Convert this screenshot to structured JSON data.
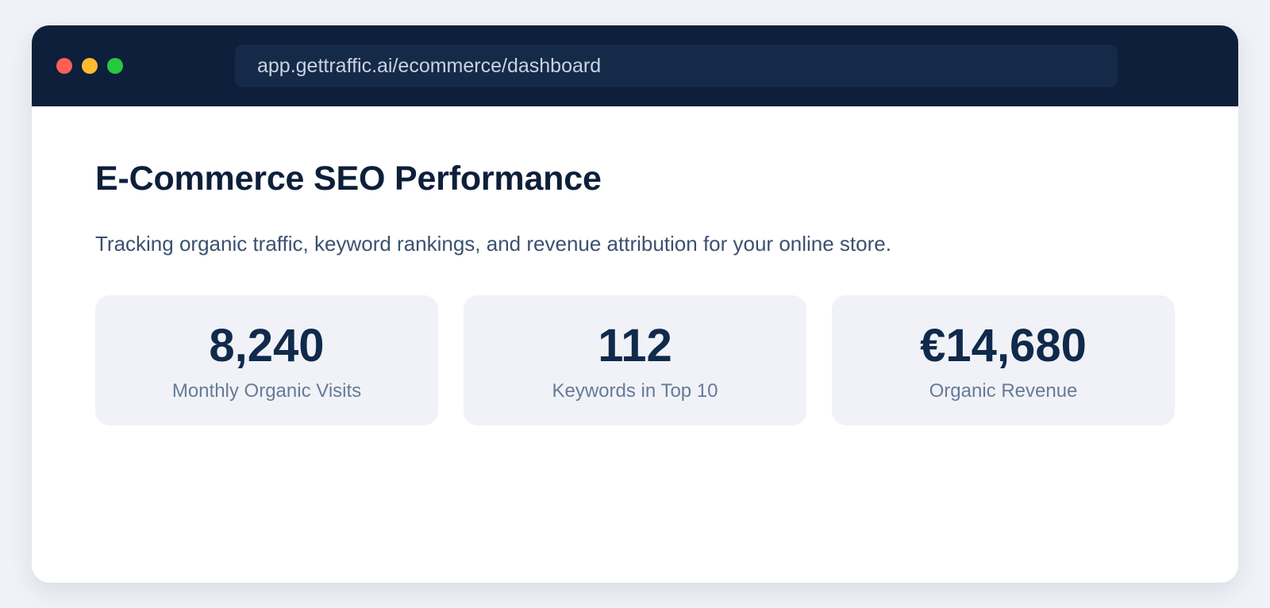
{
  "browser": {
    "url": "app.gettraffic.ai/ecommerce/dashboard"
  },
  "page": {
    "title": "E-Commerce SEO Performance",
    "subtitle": "Tracking organic traffic, keyword rankings, and revenue attribution for your online store."
  },
  "stats": [
    {
      "value": "8,240",
      "label": "Monthly Organic Visits"
    },
    {
      "value": "112",
      "label": "Keywords in Top 10"
    },
    {
      "value": "€14,680",
      "label": "Organic Revenue"
    }
  ],
  "colors": {
    "background": "#f0f2f7",
    "titlebar": "#0d1f3a",
    "address_bar": "#152a48",
    "heading": "#0d1f3a",
    "stat_value": "#102a4c",
    "stat_label": "#667b98",
    "traffic_red": "#ff5f57",
    "traffic_yellow": "#febc2e",
    "traffic_green": "#28c840"
  }
}
